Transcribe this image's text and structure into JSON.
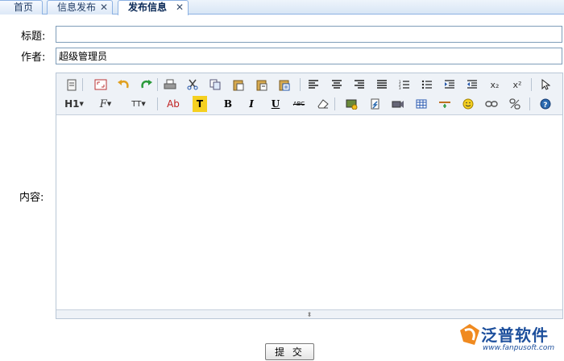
{
  "tabs": [
    {
      "label": "首页"
    },
    {
      "label": "信息发布",
      "close": "✕"
    },
    {
      "label": "发布信息",
      "close": "✕",
      "active": true
    }
  ],
  "form": {
    "title_label": "标题:",
    "title_value": "",
    "author_label": "作者:",
    "author_value": "超级管理员",
    "content_label": "内容:"
  },
  "toolbar": {
    "heading_label": "H1",
    "font_label": "F",
    "size_label": "TT",
    "forecolor_label": "Ab",
    "highlight_label": "T",
    "bold_label": "B",
    "italic_label": "I",
    "underline_label": "U",
    "strike_label": "ABC",
    "subscript_label": "x₂",
    "superscript_label": "x²",
    "help_label": "?"
  },
  "submit_label": "提 交",
  "logo": {
    "name": "泛普软件",
    "url": "www.fanpusoft.com"
  },
  "colors": {
    "tab_border": "#8db2e3",
    "brand": "#1d4f9c",
    "toolbar_bg": "#eef2f7"
  }
}
